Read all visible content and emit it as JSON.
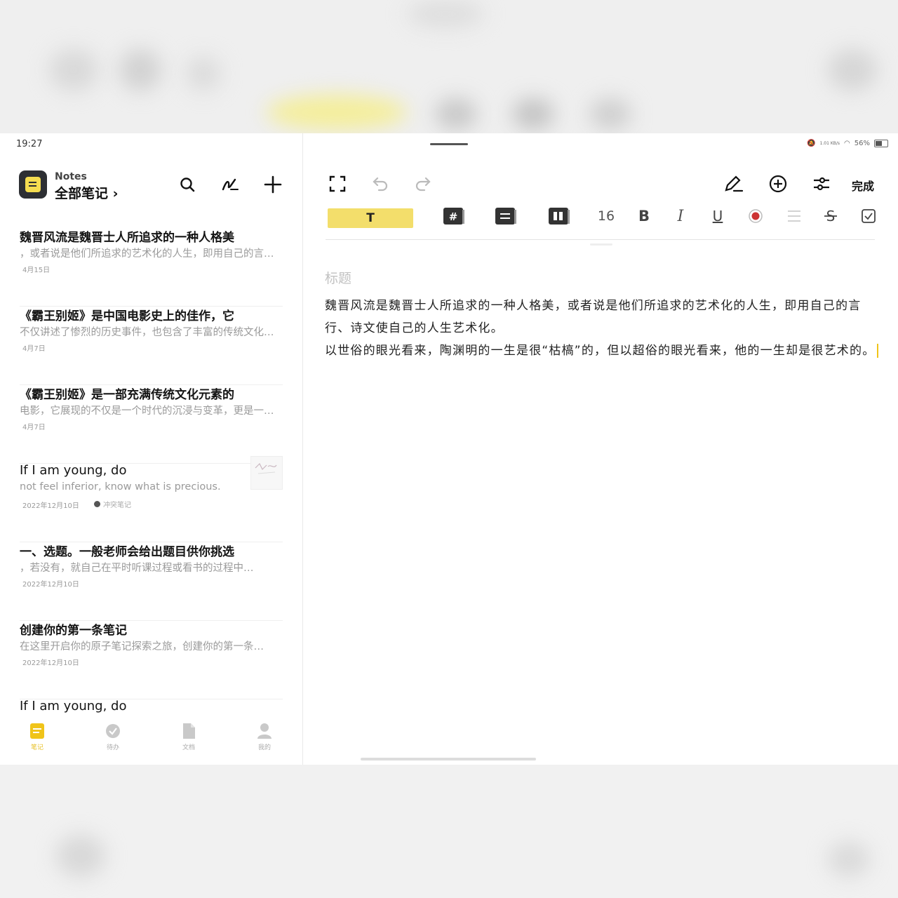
{
  "status": {
    "time": "19:27",
    "battery": "56%",
    "signal": "1.01 KB/s"
  },
  "app": {
    "name": "Notes",
    "folder_title": "全部笔记 ›"
  },
  "notes": [
    {
      "title": "魏晋风流是魏晋士人所追求的一种人格美",
      "preview": "，或者说是他们所追求的艺术化的人生，即用自己的言行…",
      "date": "4月15日"
    },
    {
      "title": "《霸王别姬》是中国电影史上的佳作，它",
      "preview": "不仅讲述了惨烈的历史事件，也包含了丰富的传统文化…",
      "date": "4月7日"
    },
    {
      "title": "《霸王别姬》是一部充满传统文化元素的",
      "preview": "电影，它展现的不仅是一个时代的沉浸与变革，更是一种…",
      "date": "4月7日"
    },
    {
      "title": "If I am young, do",
      "preview": "not feel inferior, know what is precious.",
      "date": "2022年12月10日",
      "tag": "冲突笔记"
    },
    {
      "title": "一、选题。一般老师会给出题目供你挑选",
      "preview": "，若没有，就自己在平时听课过程或看书的过程中…",
      "date": "2022年12月10日"
    },
    {
      "title": "创建你的第一条笔记",
      "preview": "在这里开启你的原子笔记探索之旅，创建你的第一条…",
      "date": "2022年12月10日"
    },
    {
      "title": "If I am young, do",
      "preview": "",
      "date": ""
    }
  ],
  "tabs": [
    {
      "label": "笔记"
    },
    {
      "label": "待办"
    },
    {
      "label": "文档"
    },
    {
      "label": "我的"
    }
  ],
  "editor": {
    "done_label": "完成",
    "style_label": "T",
    "font_size": "16",
    "title_placeholder": "标题",
    "paragraphs": [
      "魏晋风流是魏晋士人所追求的一种人格美，或者说是他们所追求的艺术化的人生，即用自己的言行、诗文使自己的人生艺术化。",
      "以世俗的眼光看来，陶渊明的一生是很“枯槁”的，但以超俗的眼光看来，他的一生却是很艺术的。"
    ]
  },
  "colors": {
    "accent": "#f3de6b",
    "accent_text": "#e8c22b",
    "logo_bg": "#2d2f33"
  }
}
